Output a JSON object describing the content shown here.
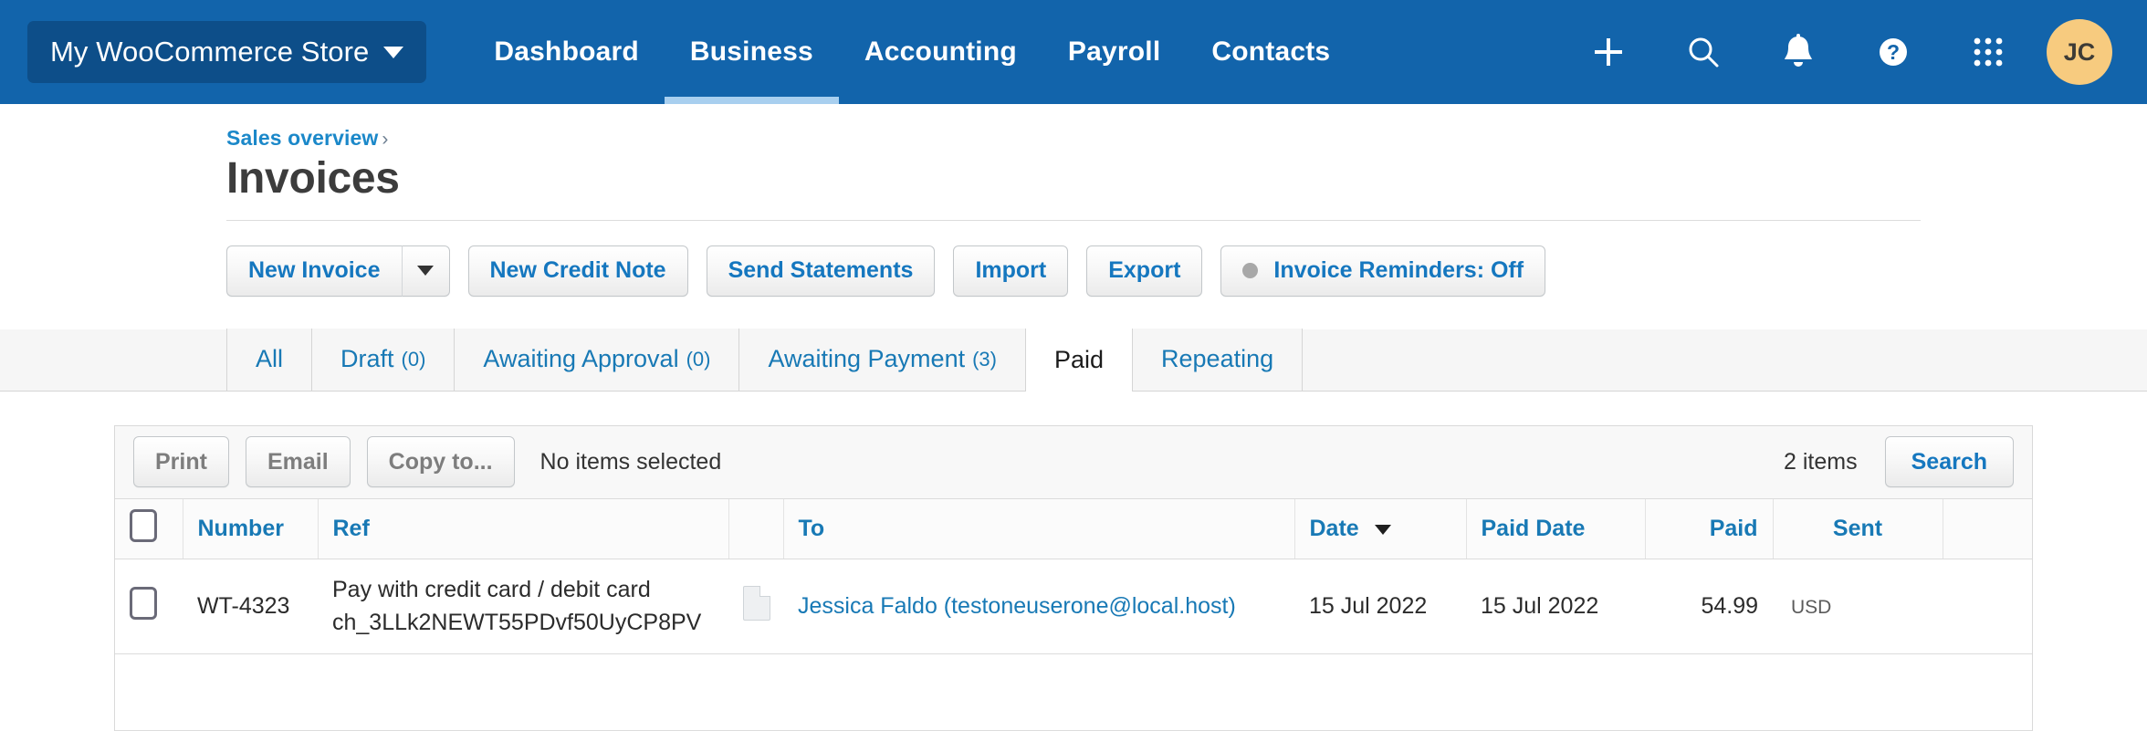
{
  "topnav": {
    "org_name": "My WooCommerce Store",
    "org_caret_icon": "chevron-down-icon",
    "links": [
      {
        "label": "Dashboard",
        "active": false
      },
      {
        "label": "Business",
        "active": true
      },
      {
        "label": "Accounting",
        "active": false
      },
      {
        "label": "Payroll",
        "active": false
      },
      {
        "label": "Contacts",
        "active": false
      }
    ],
    "icons": [
      {
        "name": "plus-icon",
        "glyph": "+"
      },
      {
        "name": "search-icon",
        "glyph": "search"
      },
      {
        "name": "bell-icon",
        "glyph": "bell"
      },
      {
        "name": "help-icon",
        "glyph": "?"
      },
      {
        "name": "apps-grid-icon",
        "glyph": "grid"
      }
    ],
    "avatar_initials": "JC",
    "avatar_color": "#f7cb7f",
    "background_color": "#1264ab"
  },
  "header": {
    "breadcrumb_label": "Sales overview",
    "breadcrumb_separator": "›",
    "page_title": "Invoices"
  },
  "toolbar": {
    "new_invoice_label": "New Invoice",
    "new_invoice_caret_icon": "chevron-down-icon",
    "new_credit_note_label": "New Credit Note",
    "send_statements_label": "Send Statements",
    "import_label": "Import",
    "export_label": "Export",
    "invoice_reminders_label": "Invoice Reminders: Off",
    "invoice_reminders_status_color": "#a8a8a8"
  },
  "tabs": [
    {
      "label": "All",
      "count": "",
      "active": false
    },
    {
      "label": "Draft",
      "count": "(0)",
      "active": false
    },
    {
      "label": "Awaiting Approval",
      "count": "(0)",
      "active": false
    },
    {
      "label": "Awaiting Payment",
      "count": "(3)",
      "active": false
    },
    {
      "label": "Paid",
      "count": "",
      "active": true
    },
    {
      "label": "Repeating",
      "count": "",
      "active": false
    }
  ],
  "actionbar": {
    "print_label": "Print",
    "email_label": "Email",
    "copy_to_label": "Copy to...",
    "selection_status": "No items selected",
    "items_count": "2 items",
    "search_label": "Search"
  },
  "table": {
    "select_all_icon": "checkbox-unchecked-icon",
    "columns": [
      {
        "key": "number",
        "label": "Number",
        "align": "left"
      },
      {
        "key": "ref",
        "label": "Ref",
        "align": "left"
      },
      {
        "key": "attachment",
        "label": "",
        "align": "left"
      },
      {
        "key": "to",
        "label": "To",
        "align": "left"
      },
      {
        "key": "date",
        "label": "Date",
        "align": "left",
        "sorted": "desc",
        "sort_icon": "caret-down-icon"
      },
      {
        "key": "paid_date",
        "label": "Paid Date",
        "align": "left"
      },
      {
        "key": "paid",
        "label": "Paid",
        "align": "right"
      },
      {
        "key": "sent",
        "label": "Sent",
        "align": "center"
      }
    ],
    "rows": [
      {
        "checkbox_icon": "checkbox-unchecked-icon",
        "number": "WT-4323",
        "ref_line1": "Pay with credit card / debit card",
        "ref_line2": "ch_3LLk2NEWT55PDvf50UyCP8PV",
        "attachment_icon": "document-icon",
        "to": "Jessica Faldo (testoneuserone@local.host)",
        "date": "15 Jul 2022",
        "paid_date": "15 Jul 2022",
        "paid_amount": "54.99",
        "paid_currency": "USD",
        "sent": ""
      }
    ]
  },
  "theme": {
    "nav_blue": "#1264ab",
    "link_blue": "#1879b5",
    "accent_blue": "#1577bf",
    "text_dark": "#3c3c3c"
  }
}
